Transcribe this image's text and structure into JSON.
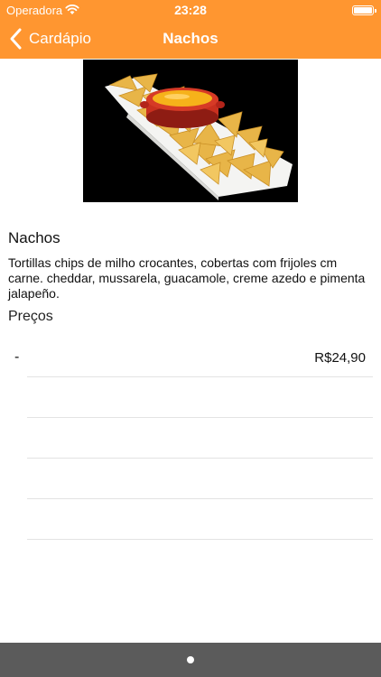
{
  "status_bar": {
    "carrier": "Operadora",
    "time": "23:28"
  },
  "nav": {
    "back_label": "Cardápio",
    "title": "Nachos"
  },
  "product": {
    "image_icon": "nachos-photo",
    "name": "Nachos",
    "description": "Tortillas chips de milho crocantes, cobertas com frijoles cm carne. cheddar, mussarela, guacamole, creme azedo e pimenta jalapeño.",
    "prices_title": "Preços",
    "prices": [
      {
        "label": "-",
        "value": "R$24,90"
      }
    ]
  },
  "colors": {
    "accent": "#FF9630",
    "bottom_bar": "#5B5B5B"
  }
}
